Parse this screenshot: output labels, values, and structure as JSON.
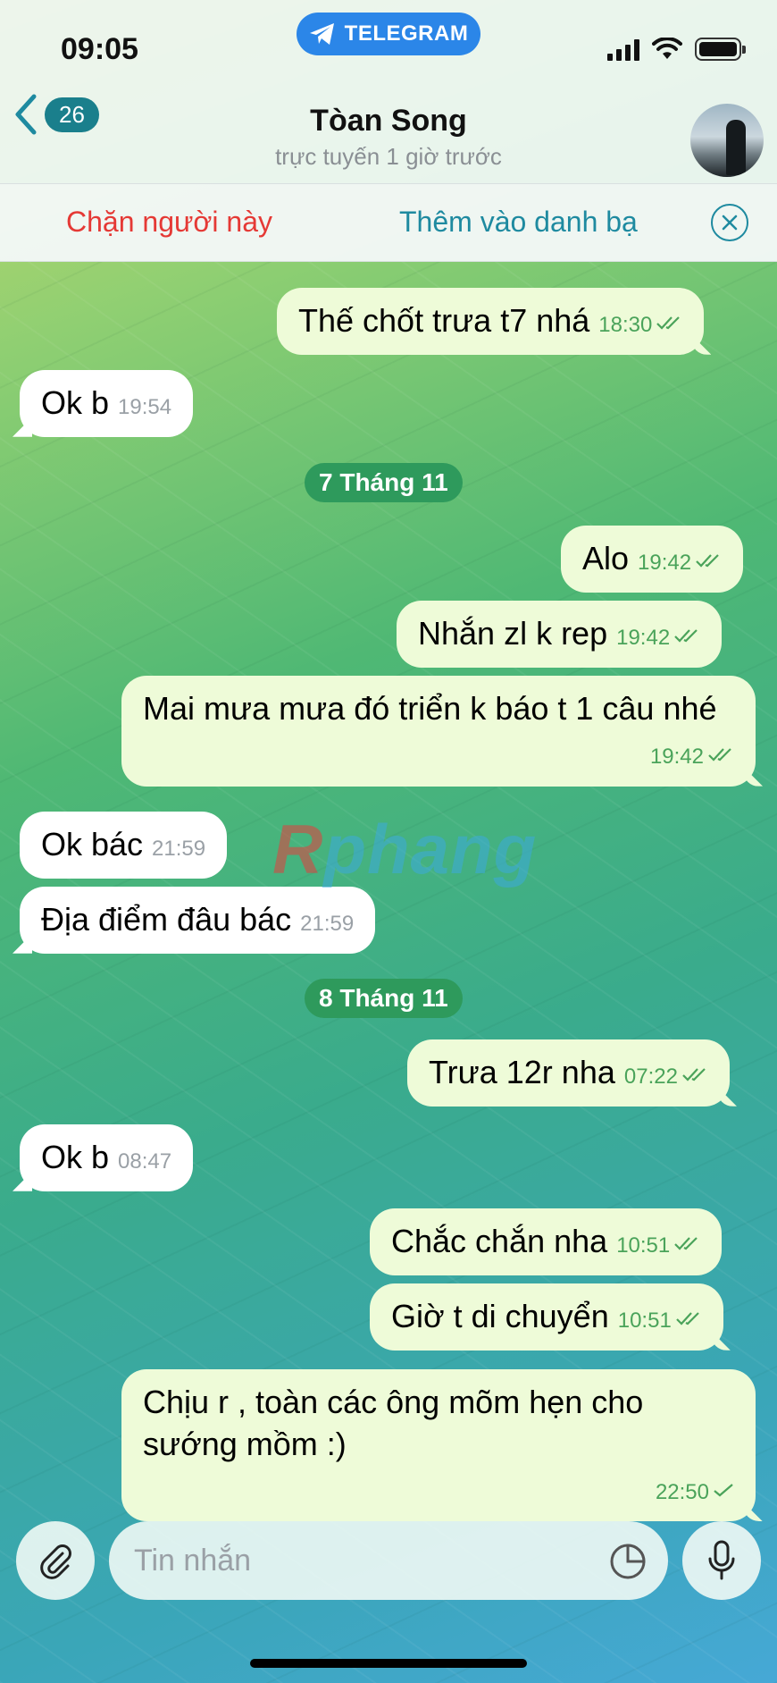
{
  "status": {
    "time": "09:05",
    "app_pill": "TELEGRAM"
  },
  "header": {
    "back_count": "26",
    "contact_name": "Tòan Song",
    "contact_status": "trực tuyến 1 giờ trước"
  },
  "actions": {
    "block": "Chặn người này",
    "add_contact": "Thêm vào danh bạ"
  },
  "messages": [
    {
      "text": "Thế chốt trưa t7 nhá",
      "time": "18:30"
    },
    {
      "text": "Ok b",
      "time": "19:54"
    },
    {
      "date": "7 Tháng 11"
    },
    {
      "text": "Alo",
      "time": "19:42"
    },
    {
      "text": "Nhắn zl k rep",
      "time": "19:42"
    },
    {
      "text": "Mai mưa mưa đó triển k báo t 1 câu nhé",
      "time": "19:42"
    },
    {
      "text": "Ok bác",
      "time": "21:59"
    },
    {
      "text": "Địa điểm đâu bác",
      "time": "21:59"
    },
    {
      "date": "8 Tháng 11"
    },
    {
      "text": "Trưa 12r nha",
      "time": "07:22"
    },
    {
      "text": "Ok b",
      "time": "08:47"
    },
    {
      "text": "Chắc chắn nha",
      "time": "10:51"
    },
    {
      "text": "Giờ t di chuyển",
      "time": "10:51"
    },
    {
      "text": "Chịu r , toàn các ông mõm hẹn cho sướng mồm :)",
      "time": "22:50"
    }
  ],
  "watermark": {
    "first": "R",
    "rest": "phang"
  },
  "input": {
    "placeholder": "Tin nhắn"
  },
  "colors": {
    "incoming": "#ffffff",
    "outgoing": "#eefbd8",
    "accent": "#1e8aa0",
    "danger": "#e53935",
    "date_pill": "#2e9a5c"
  }
}
